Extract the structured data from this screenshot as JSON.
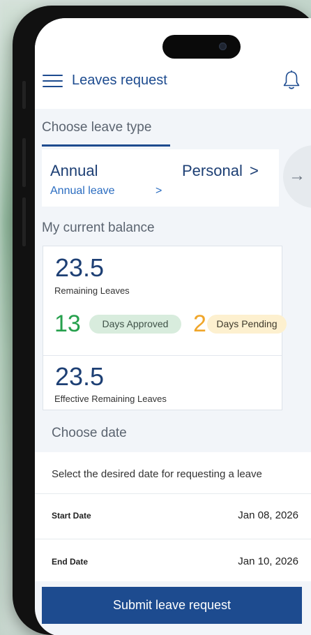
{
  "header": {
    "title": "Leaves request",
    "menu_icon": "hamburger-menu-icon",
    "notification_icon": "bell-icon"
  },
  "leave_type": {
    "section_label": "Choose leave type",
    "selected": {
      "title": "Annual",
      "subtitle": "Annual leave",
      "chevron": ">"
    },
    "next_option": {
      "title": "Personal",
      "chevron": ">"
    },
    "scroll_arrow": "→"
  },
  "balance": {
    "section_label": "My current balance",
    "remaining_value": "23.5",
    "remaining_label": "Remaining Leaves",
    "approved_count": "13",
    "approved_label": "Days Approved",
    "pending_count": "2",
    "pending_label": "Days Pending",
    "effective_value": "23.5",
    "effective_label": "Effective Remaining Leaves"
  },
  "date": {
    "section_label": "Choose date",
    "description": "Select the desired date for requesting a leave",
    "start_label": "Start Date",
    "start_value": "Jan 08, 2026",
    "end_label": "End Date",
    "end_value": "Jan 10, 2026"
  },
  "submit_label": "Submit leave request",
  "colors": {
    "primary": "#1d4b8f",
    "approved": "#26a04d",
    "pending": "#f0a62a"
  }
}
